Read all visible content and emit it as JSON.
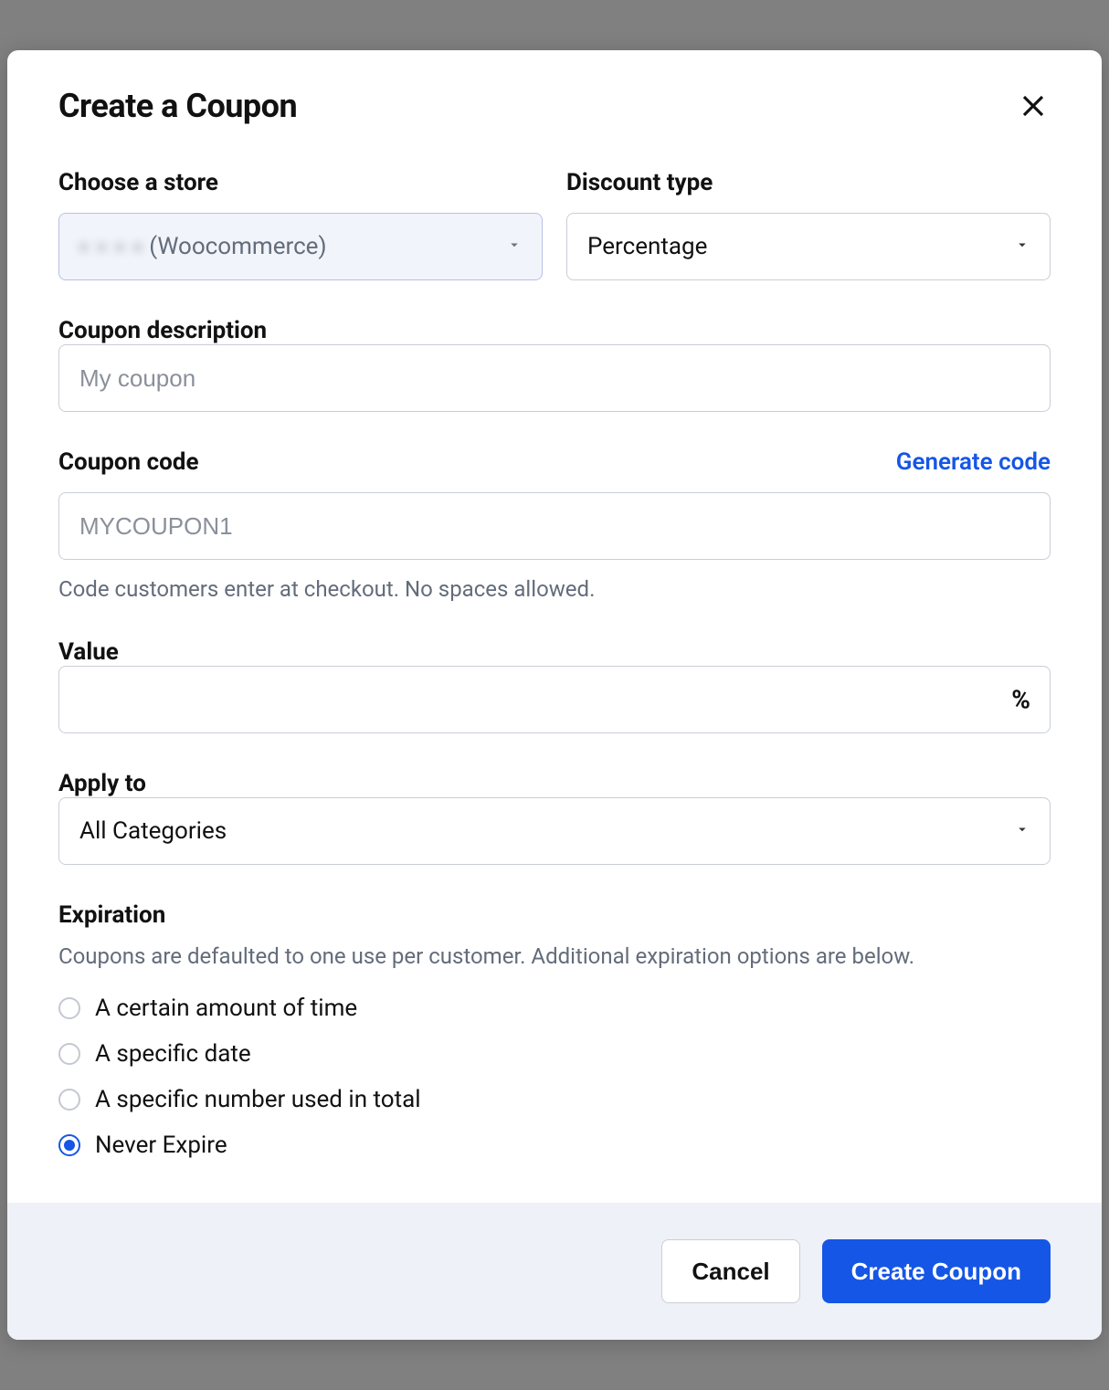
{
  "modal": {
    "title": "Create a Coupon"
  },
  "store": {
    "label": "Choose a store",
    "value_suffix": "(Woocommerce)"
  },
  "discount_type": {
    "label": "Discount type",
    "value": "Percentage"
  },
  "description": {
    "label": "Coupon description",
    "placeholder": "My coupon"
  },
  "code": {
    "label": "Coupon code",
    "generate_link": "Generate code",
    "placeholder": "MYCOUPON1",
    "helper": "Code customers enter at checkout. No spaces allowed."
  },
  "value": {
    "label": "Value",
    "suffix": "%"
  },
  "apply_to": {
    "label": "Apply to",
    "value": "All Categories"
  },
  "expiration": {
    "label": "Expiration",
    "desc": "Coupons are defaulted to one use per customer. Additional expiration options are below.",
    "options": [
      {
        "label": "A certain amount of time",
        "checked": false
      },
      {
        "label": "A specific date",
        "checked": false
      },
      {
        "label": "A specific number used in total",
        "checked": false
      },
      {
        "label": "Never Expire",
        "checked": true
      }
    ]
  },
  "footer": {
    "cancel": "Cancel",
    "submit": "Create Coupon"
  }
}
